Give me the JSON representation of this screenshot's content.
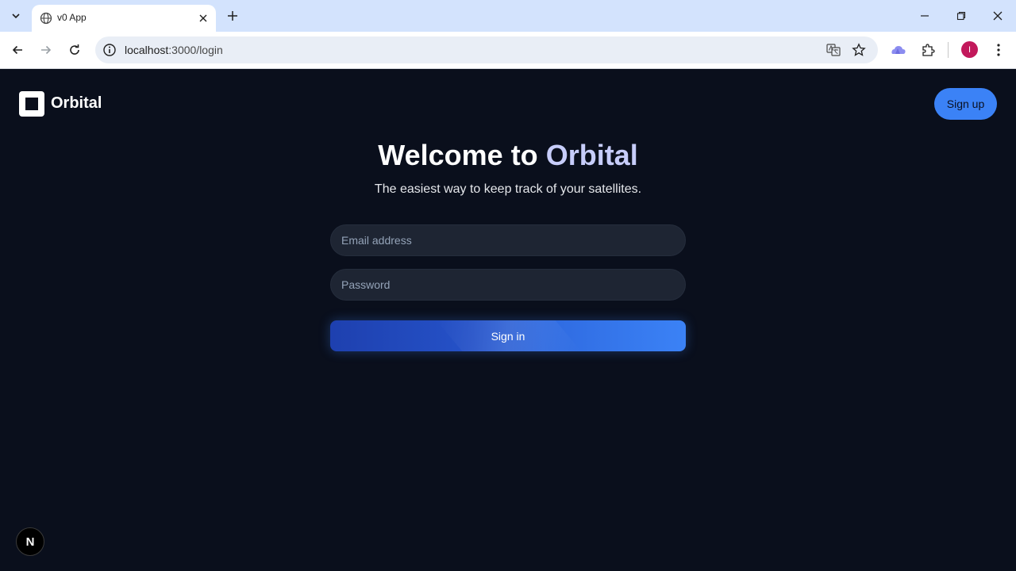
{
  "browser": {
    "tab_title": "v0 App",
    "url_host": "localhost",
    "url_path": ":3000/login",
    "profile_initial": "I"
  },
  "header": {
    "brand": "Orbital",
    "signup_label": "Sign up"
  },
  "hero": {
    "title_prefix": "Welcome to ",
    "title_accent": "Orbital",
    "subtitle": "The easiest way to keep track of your satellites."
  },
  "form": {
    "email_placeholder": "Email address",
    "password_placeholder": "Password",
    "signin_label": "Sign in"
  },
  "badge": {
    "letter": "N"
  },
  "colors": {
    "page_bg": "#0a0f1c",
    "accent": "#3b82f6",
    "title_accent": "#c7cdfa"
  }
}
